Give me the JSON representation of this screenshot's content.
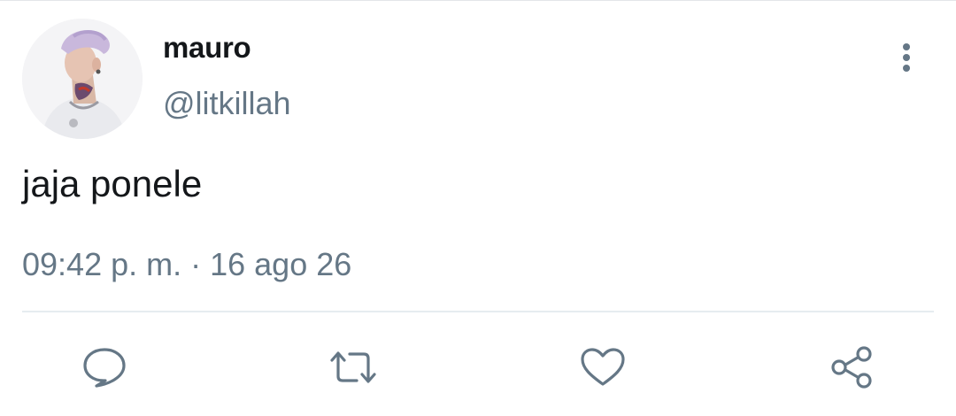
{
  "user": {
    "display_name": "mauro",
    "handle": "@litkillah",
    "avatar_icon": "profile-photo"
  },
  "tweet": {
    "text": "jaja ponele",
    "time": "09:42 p. m.",
    "separator": "·",
    "date": "16 ago 26"
  },
  "actions": [
    {
      "name": "reply",
      "icon": "reply-icon"
    },
    {
      "name": "retweet",
      "icon": "retweet-icon"
    },
    {
      "name": "like",
      "icon": "heart-icon"
    },
    {
      "name": "share",
      "icon": "share-icon"
    }
  ],
  "menu": {
    "icon": "more-vertical-icon"
  },
  "colors": {
    "text": "#14171a",
    "secondary": "#657786",
    "divider": "#e6ecf0"
  }
}
